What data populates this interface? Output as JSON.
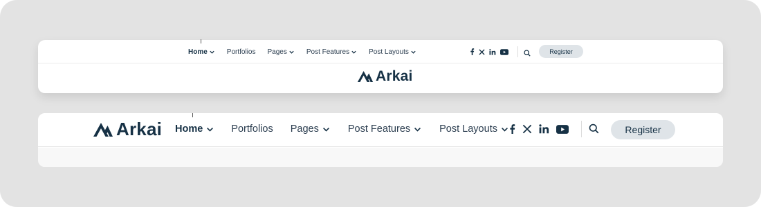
{
  "brand": {
    "name": "Arkai",
    "color": "#163145"
  },
  "header_stacked": {
    "nav": [
      {
        "label": "Home",
        "has_dropdown": true,
        "active": true
      },
      {
        "label": "Portfolios",
        "has_dropdown": false
      },
      {
        "label": "Pages",
        "has_dropdown": true
      },
      {
        "label": "Post Features",
        "has_dropdown": true
      },
      {
        "label": "Post Layouts",
        "has_dropdown": true
      }
    ],
    "social": [
      "facebook-icon",
      "x-twitter-icon",
      "linkedin-icon",
      "youtube-icon"
    ],
    "register_label": "Register",
    "logo_text": "Arkai"
  },
  "header_inline": {
    "logo_text": "Arkai",
    "nav": [
      {
        "label": "Home",
        "has_dropdown": true,
        "active": true
      },
      {
        "label": "Portfolios",
        "has_dropdown": false
      },
      {
        "label": "Pages",
        "has_dropdown": true
      },
      {
        "label": "Post Features",
        "has_dropdown": true
      },
      {
        "label": "Post Layouts",
        "has_dropdown": true
      }
    ],
    "social": [
      "facebook-icon",
      "x-twitter-icon",
      "linkedin-icon",
      "youtube-icon"
    ],
    "register_label": "Register"
  },
  "colors": {
    "background": "#e3e3e3",
    "button_bg": "#dfe4e8",
    "text": "#163145"
  }
}
